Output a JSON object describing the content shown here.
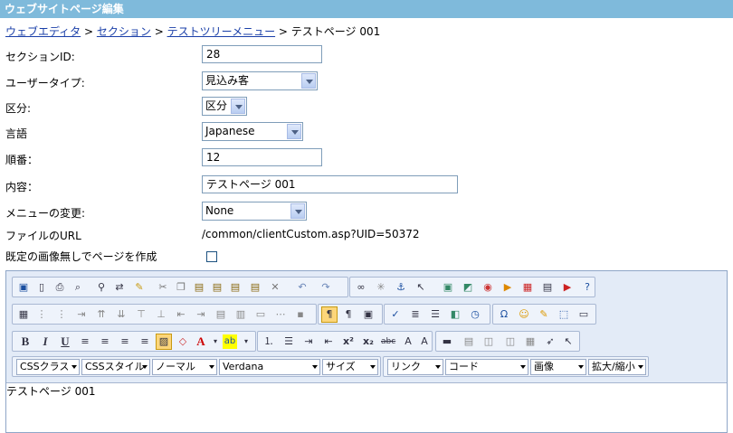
{
  "window": {
    "title": "ウェブサイトページ編集"
  },
  "breadcrumb": {
    "items": [
      "ウェブエディタ",
      "セクション",
      "テストツリーメニュー"
    ],
    "current": "テストページ 001",
    "sep": " > "
  },
  "form": {
    "section_id": {
      "label": "セクションID:",
      "value": "28"
    },
    "user_type": {
      "label": "ユーザータイプ:",
      "value": "見込み客"
    },
    "category": {
      "label": "区分:",
      "value": "区分"
    },
    "language": {
      "label": "言語",
      "value": "Japanese"
    },
    "order": {
      "label": "順番：",
      "value": "12"
    },
    "content": {
      "label": "内容：",
      "value": "テストページ 001"
    },
    "menu_change": {
      "label": "メニューの変更:",
      "value": "None"
    },
    "file_url": {
      "label": "ファイルのURL",
      "value": "/common/clientCustom.asp?UID=50372"
    },
    "no_default_image": {
      "label": "既定の画像無しでページを作成"
    }
  },
  "editor": {
    "dropdowns": {
      "css_class": "CSSクラス",
      "css_style": "CSSスタイル",
      "format": "ノーマル",
      "font": "Verdana",
      "size": "サイズ",
      "link": "リンク",
      "code": "コード",
      "image": "画像",
      "zoom": "拡大/縮小"
    },
    "icons": {
      "row1": [
        "save-icon",
        "new-page-icon",
        "print-icon",
        "preview-icon",
        "find-icon",
        "replace-icon",
        "clean-icon",
        "cut-icon",
        "copy-icon",
        "paste-icon",
        "paste-text-icon",
        "paste-word-icon",
        "paste-html-icon",
        "delete-icon",
        "undo-icon",
        "redo-icon",
        "link-icon",
        "unlink-icon",
        "anchor-icon",
        "hyperlink-manager-icon",
        "image-manager-icon",
        "image-map-icon",
        "flash-icon",
        "media-icon",
        "pdf-icon",
        "document-icon",
        "youtube-icon",
        "help-icon"
      ],
      "row2_glyphs": "▦⋮⋮⇥⇈⇊⊤⊥⇤⇥▤▥▤▥▭⋯▪",
      "row3_glyphs": [
        "B",
        "I",
        "U",
        "≡",
        "≡",
        "≡",
        "≡",
        "▨",
        "◇",
        "A",
        "ab"
      ]
    },
    "body_text": "テストページ 001"
  }
}
